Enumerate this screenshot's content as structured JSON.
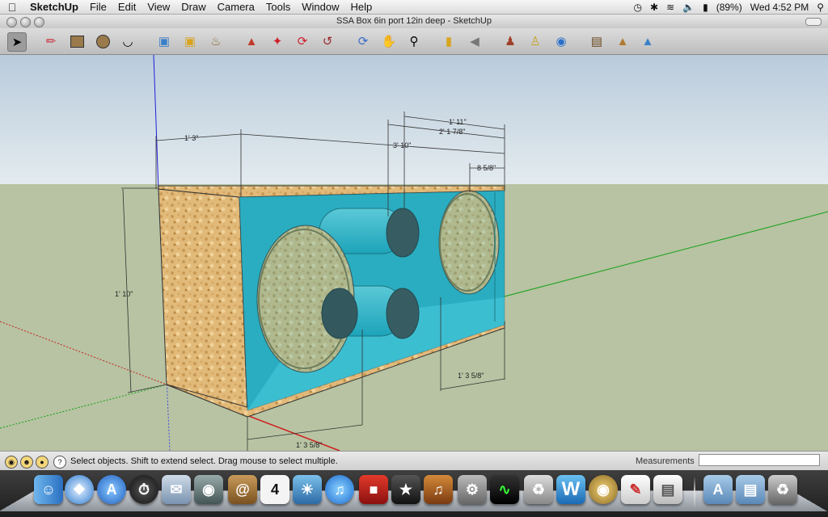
{
  "menubar": {
    "app": "SketchUp",
    "items": [
      "File",
      "Edit",
      "View",
      "Draw",
      "Camera",
      "Tools",
      "Window",
      "Help"
    ],
    "battery": "(89%)",
    "clock": "Wed 4:52 PM"
  },
  "window": {
    "title": "SSA Box 6in port 12in deep - SketchUp"
  },
  "toolbar": {
    "tools": [
      "select-tool",
      "pencil-tool",
      "rectangle-tool",
      "circle-tool",
      "arc-tool",
      "eraser-tool",
      "paint-bucket-tool",
      "tape-measure-tool",
      "push-pull-tool",
      "move-tool",
      "rotate-tool",
      "offset-tool",
      "orbit-tool",
      "pan-tool",
      "zoom-tool",
      "zoom-extents-tool",
      "previous-view-tool",
      "position-camera-tool",
      "walk-tool",
      "look-around-tool",
      "components-tool",
      "get-models-tool",
      "share-model-tool"
    ]
  },
  "dimensions": {
    "depth_top": "1' 3\"",
    "width_top": "3' 10\"",
    "right_a": "1' 11\"",
    "right_b": "2' 1 7/8\"",
    "right_c": "8 5/8\"",
    "height": "1' 10\"",
    "bottom_right": "1' 3 5/8\"",
    "bottom_left": "1' 3 5/8\""
  },
  "statusbar": {
    "message": "Select objects. Shift to extend select. Drag mouse to select multiple.",
    "measurements_label": "Measurements",
    "measurements_value": ""
  },
  "dock": {
    "apps": [
      "finder-icon",
      "safari-icon",
      "app-store-icon",
      "dashboard-icon",
      "mail-icon",
      "facetime-icon",
      "address-book-icon",
      "ical-icon",
      "iphoto-icon",
      "itunes-icon",
      "photo-booth-icon",
      "imovie-icon",
      "garageband-icon",
      "system-preferences-icon",
      "activity-monitor-icon",
      "automator-icon",
      "word-icon",
      "dvd-player-icon",
      "textedit-icon",
      "preview-icon",
      "applications-folder-icon",
      "documents-folder-icon",
      "trash-icon"
    ],
    "ical_date": "4",
    "word_letter": "W"
  },
  "colors": {
    "sky": "#c9d8e4",
    "ground": "#b8c4a3",
    "box_wood": "#e0b875",
    "box_glass": "#1fb2c9"
  }
}
